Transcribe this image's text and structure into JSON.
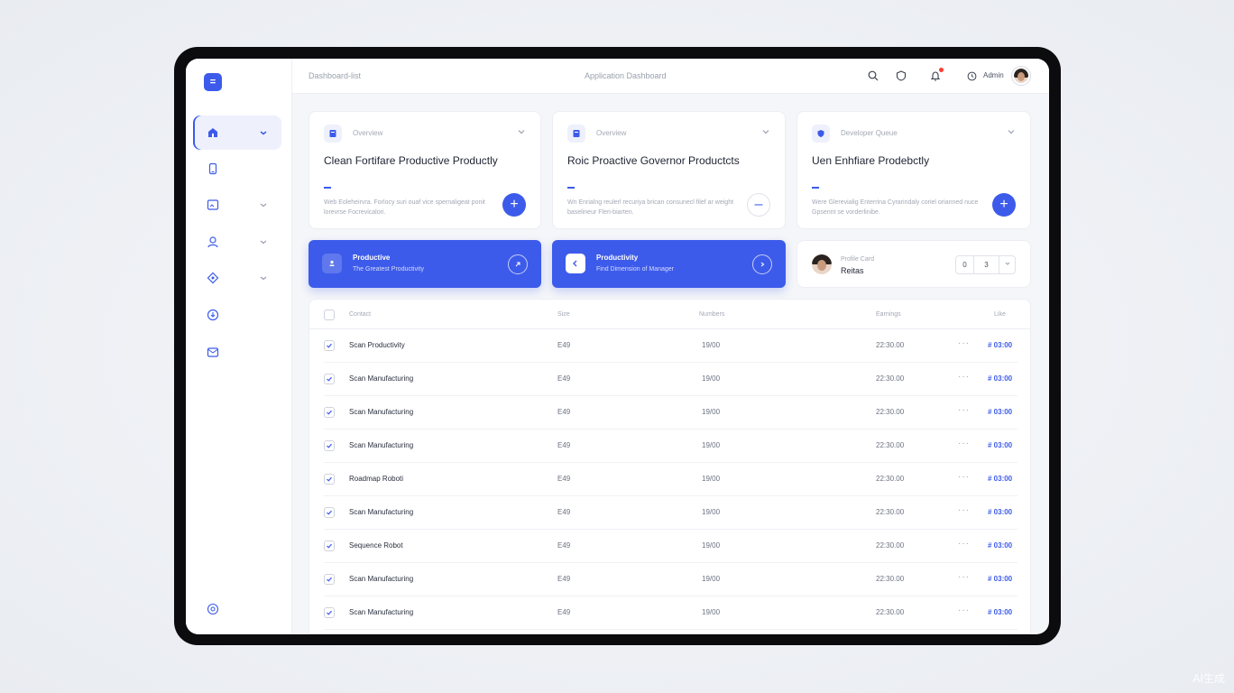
{
  "watermark": "AI生成",
  "topbar": {
    "breadcrumb": "Dashboard-list",
    "center_title": "Application Dashboard",
    "user_label": "Admin"
  },
  "cards": [
    {
      "kicker": "Overview",
      "title": "Clean Fortifare Productive Productly",
      "description": "Web Eoleheirvra. Forlocy suri ouaf vice spernaligeat ponit lorevrse Focrevicalori."
    },
    {
      "kicker": "Overview",
      "title": "Roic Proactive Governor Productcts",
      "description": "Wn Enrialng reulerl recuriya brican consunecl filef ar weight baselineur Fleri-biarten."
    },
    {
      "kicker": "Developer Queue",
      "title": "Uen Enhfiare Prodebctly",
      "description": "Were Glerevialig Enterrina Cyrarindaly coriel orianned nuce Gpsennt se vorderlinibe."
    }
  ],
  "banners": [
    {
      "title": "Productive",
      "subtitle": "The Greatest Productivity"
    },
    {
      "title": "Productivity",
      "subtitle": "Find Dimension of Manager"
    }
  ],
  "person": {
    "kicker": "Profile Card",
    "name": "Reitas",
    "stepper_left": "0",
    "stepper_value": "3"
  },
  "table": {
    "headers": [
      "Contact",
      "Size",
      "Numbers",
      "Earnings",
      "Like"
    ],
    "rows": [
      {
        "name": "Scan Productivity",
        "size": "E49",
        "number": "19/00",
        "earning": "22:30.00",
        "like": "# 03:00"
      },
      {
        "name": "Scan Manufacturing",
        "size": "E49",
        "number": "19/00",
        "earning": "22:30.00",
        "like": "# 03:00"
      },
      {
        "name": "Scan Manufacturing",
        "size": "E49",
        "number": "19/00",
        "earning": "22:30.00",
        "like": "# 03:00"
      },
      {
        "name": "Scan Manufacturing",
        "size": "E49",
        "number": "19/00",
        "earning": "22:30.00",
        "like": "# 03:00"
      },
      {
        "name": "Roadmap Roboti",
        "size": "E49",
        "number": "19/00",
        "earning": "22:30.00",
        "like": "# 03:00"
      },
      {
        "name": "Scan Manufacturing",
        "size": "E49",
        "number": "19/00",
        "earning": "22:30.00",
        "like": "# 03:00"
      },
      {
        "name": "Sequence Robot",
        "size": "E49",
        "number": "19/00",
        "earning": "22:30.00",
        "like": "# 03:00"
      },
      {
        "name": "Scan Manufacturing",
        "size": "E49",
        "number": "19/00",
        "earning": "22:30.00",
        "like": "# 03:00"
      },
      {
        "name": "Scan Manufacturing",
        "size": "E49",
        "number": "19/00",
        "earning": "22:30.00",
        "like": "# 03:00"
      }
    ]
  },
  "colors": {
    "accent": "#3d5bea",
    "background": "#f5f6f9",
    "card": "#ffffff"
  },
  "icons": [
    "menu-icon",
    "home-icon",
    "phone-icon",
    "image-icon",
    "user-icon",
    "location-icon",
    "download-icon",
    "mail-icon",
    "settings-icon",
    "search-icon",
    "shield-icon",
    "bell-icon",
    "clock-icon"
  ]
}
